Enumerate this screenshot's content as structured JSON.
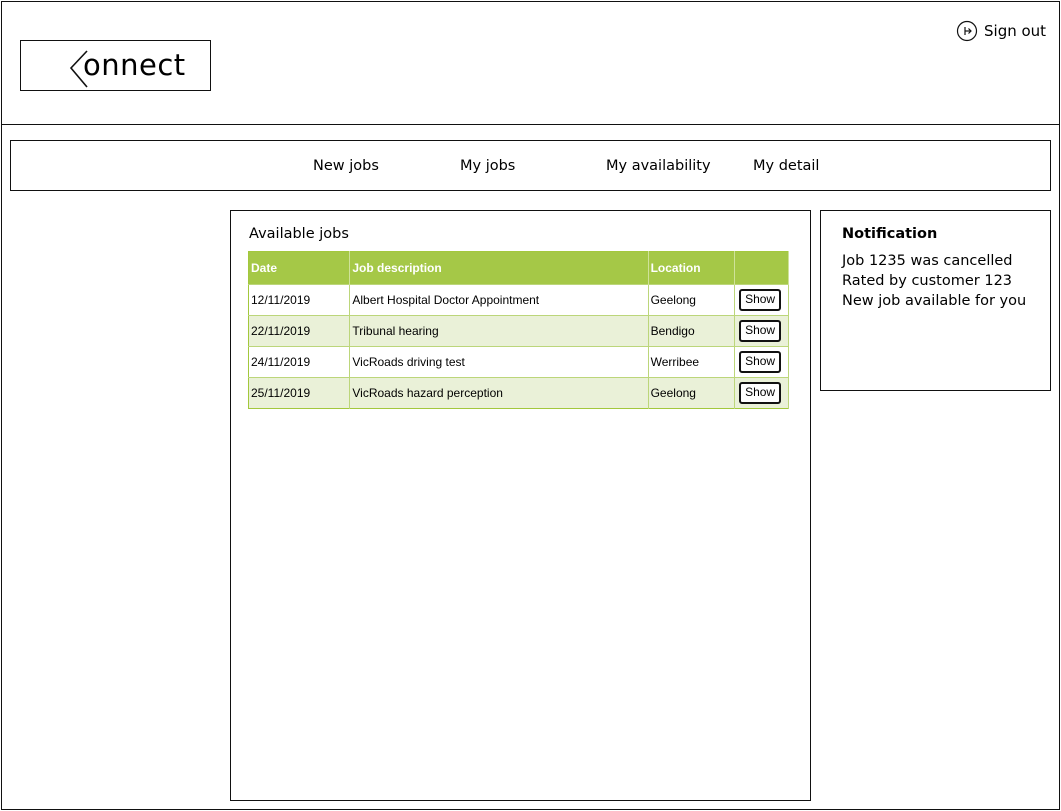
{
  "header": {
    "logo_text": "onnect",
    "sign_out_label": "Sign out"
  },
  "nav": {
    "items": [
      {
        "label": "New jobs"
      },
      {
        "label": "My jobs"
      },
      {
        "label": "My availability"
      },
      {
        "label": "My detail"
      }
    ]
  },
  "main": {
    "title": "Available jobs",
    "table": {
      "columns": [
        "Date",
        "Job description",
        "Location",
        ""
      ],
      "rows": [
        {
          "date": "12/11/2019",
          "description": "Albert Hospital Doctor Appointment",
          "location": "Geelong",
          "action": "Show"
        },
        {
          "date": "22/11/2019",
          "description": "Tribunal hearing",
          "location": "Bendigo",
          "action": "Show"
        },
        {
          "date": "24/11/2019",
          "description": "VicRoads driving test",
          "location": "Werribee",
          "action": "Show"
        },
        {
          "date": "25/11/2019",
          "description": "VicRoads hazard perception",
          "location": "Geelong",
          "action": "Show"
        }
      ]
    }
  },
  "notifications": {
    "title": "Notification",
    "items": [
      "Job 1235 was cancelled",
      "Rated by customer 123",
      "New job available for you"
    ]
  },
  "colors": {
    "table_header": "#a5c847",
    "table_alt_row": "#eaf1d8",
    "border": "#111111"
  }
}
